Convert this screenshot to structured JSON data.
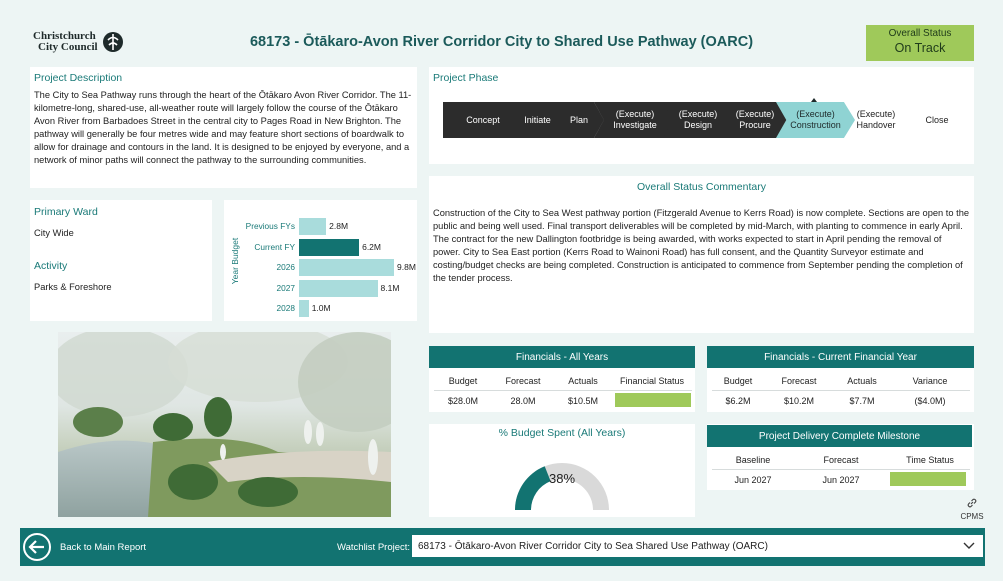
{
  "header": {
    "logo_line1": "Christchurch",
    "logo_line2": "City Council",
    "title": "68173 - Ōtākaro-Avon River Corridor City to Shared Use Pathway (OARC)",
    "status_label": "Overall Status",
    "status_value": "On Track"
  },
  "description": {
    "title": "Project Description",
    "text": "The City to Sea Pathway runs through the heart of the Ōtākaro Avon River Corridor. The 11-kilometre-long, shared-use, all-weather route will largely follow the course of the Ōtākaro Avon River from Barbadoes Street in the central city to Pages Road in New Brighton. The pathway will generally be four metres wide and may feature short sections of boardwalk to allow for drainage and contours in the land. It is designed to be enjoyed by everyone, and a network of minor paths will connect the pathway to the surrounding communities."
  },
  "ward": {
    "primary_ward_label": "Primary Ward",
    "primary_ward_value": "City Wide",
    "activity_label": "Activity",
    "activity_value": "Parks & Foreshore"
  },
  "budget_chart": {
    "axis_label": "Year Budget"
  },
  "chart_data": {
    "type": "bar",
    "orientation": "horizontal",
    "ylabel": "Year Budget",
    "categories": [
      "Previous FYs",
      "Current FY",
      "2026",
      "2027",
      "2028"
    ],
    "values": [
      2.8,
      6.2,
      9.8,
      8.1,
      1.0
    ],
    "value_labels": [
      "2.8M",
      "6.2M",
      "9.8M",
      "8.1M",
      "1.0M"
    ],
    "highlight_index": 1,
    "colors": {
      "normal": "#a9dcdc",
      "highlight": "#127371"
    }
  },
  "phase": {
    "title": "Project Phase",
    "steps": [
      {
        "label": "Concept",
        "state": "done"
      },
      {
        "label": "Initiate",
        "state": "done"
      },
      {
        "label": "Plan",
        "state": "done"
      },
      {
        "label": "(Execute) Investigate",
        "state": "done"
      },
      {
        "label": "(Execute) Design",
        "state": "done"
      },
      {
        "label": "(Execute) Procure",
        "state": "done"
      },
      {
        "label": "(Execute) Construction",
        "state": "current"
      },
      {
        "label": "(Execute) Handover",
        "state": "future"
      },
      {
        "label": "Close",
        "state": "future"
      }
    ]
  },
  "commentary": {
    "title": "Overall Status Commentary",
    "text": "Construction of the City to Sea West pathway portion (Fitzgerald Avenue to Kerrs Road) is now complete. Sections are open to the public and being well used. Final transport deliverables will be completed by mid-March, with planting to commence in early April. The contract for the new Dallington footbridge is being awarded, with works expected to start in April pending the removal of power. City to Sea East portion (Kerrs Road to Wainoni Road) has full consent, and the Quantity Surveyor estimate and costing/budget checks are being completed. Construction is anticipated to commence from September pending the completion of the tender process."
  },
  "financials_all": {
    "title": "Financials - All Years",
    "headers": [
      "Budget",
      "Forecast",
      "Actuals",
      "Financial Status"
    ],
    "values": [
      "$28.0M",
      "28.0M",
      "$10.5M"
    ],
    "status_color": "#9fc95a"
  },
  "financials_current": {
    "title": "Financials - Current Financial Year",
    "headers": [
      "Budget",
      "Forecast",
      "Actuals",
      "Variance"
    ],
    "values": [
      "$6.2M",
      "$10.2M",
      "$7.7M",
      "($4.0M)"
    ]
  },
  "budget_spent": {
    "title": "% Budget Spent (All Years)",
    "percent_label": "38%",
    "percent": 0.38
  },
  "milestone": {
    "title": "Project Delivery Complete Milestone",
    "headers": [
      "Baseline",
      "Forecast",
      "Time Status"
    ],
    "values": [
      "Jun 2027",
      "Jun 2027"
    ],
    "status_color": "#9fc95a"
  },
  "cpms": {
    "label": "CPMS"
  },
  "footer": {
    "back_label": "Back to Main Report",
    "watchlist_label": "Watchlist Project:",
    "watchlist_value": "68173 - Ōtākaro-Avon River Corridor City to Sea Shared Use Pathway (OARC)"
  }
}
